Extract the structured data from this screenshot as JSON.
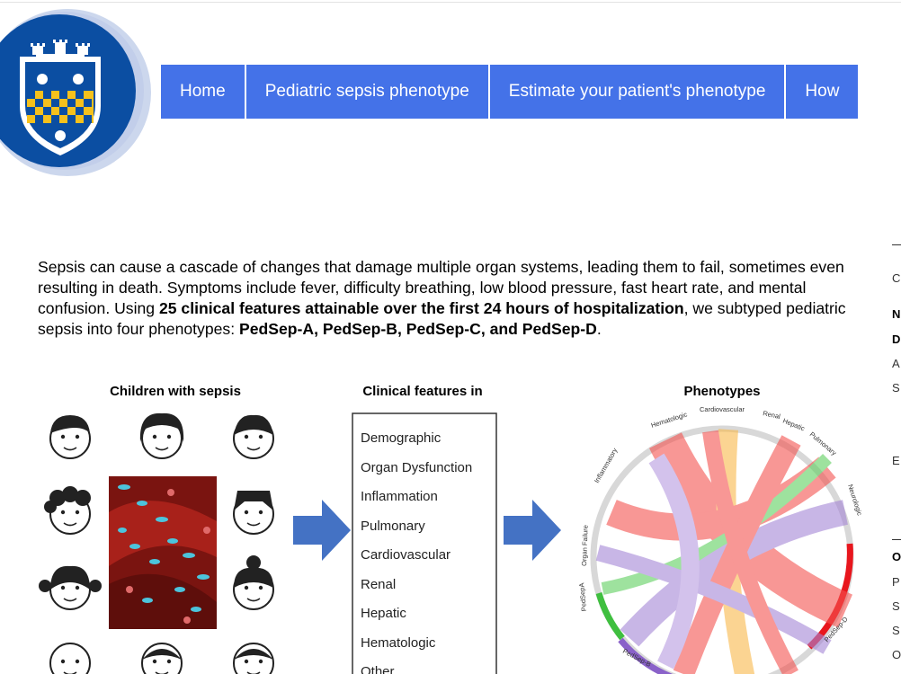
{
  "nav": {
    "items": [
      {
        "label": "Home"
      },
      {
        "label": "Pediatric sepsis phenotype"
      },
      {
        "label": "Estimate your patient's phenotype"
      },
      {
        "label": "How"
      }
    ]
  },
  "intro": {
    "p1": "Sepsis can cause a cascade of changes that damage multiple organ systems, leading them to fail, sometimes even resulting in death. Symptoms include fever, difficulty breathing, low blood pressure, fast heart rate, and mental confusion. Using ",
    "b1": "25 clinical features attainable over the first 24 hours of hospitalization",
    "p2": ", we subtyped pediatric sepsis into four phenotypes: ",
    "b2": "PedSep-A, PedSep-B, PedSep-C, and PedSep-D",
    "p3": "."
  },
  "figure": {
    "col1_title": "Children with sepsis",
    "col2_title": "Clinical features in",
    "col3_title": "Phenotypes",
    "features": [
      "Demographic",
      "Organ Dysfunction",
      "Inflammation",
      "Pulmonary",
      "Cardiovascular",
      "Renal",
      "Hepatic",
      "Hematologic",
      "Other"
    ],
    "chord_labels": [
      "Hematologic",
      "Cardiovascular",
      "Renal",
      "Hepatic",
      "Pulmonary",
      "Neurologic",
      "Inflammatory",
      "Organ Failure",
      "PedSepA",
      "PedSep-B",
      "PedSep-D"
    ]
  },
  "sidebar": {
    "letters": [
      "C",
      "N",
      "D",
      "A",
      "S",
      "E",
      "O",
      "P",
      "S",
      "S",
      "O"
    ]
  },
  "colors": {
    "nav": "#4472e8",
    "shield": "#0b4ea2",
    "gold": "#f6c11c",
    "pedsep_a": "#3fbf3f",
    "pedsep_b": "#8a62c9",
    "pedsep_d": "#e8161d"
  }
}
